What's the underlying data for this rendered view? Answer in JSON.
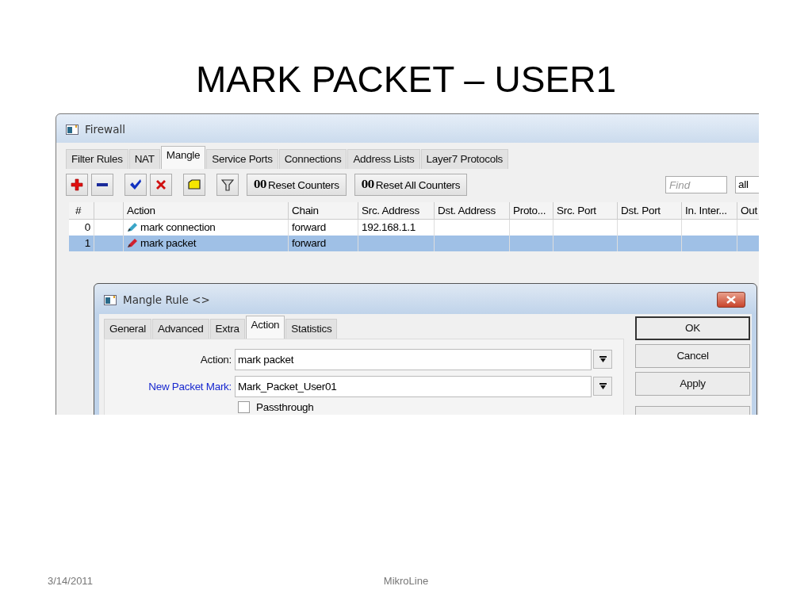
{
  "slide": {
    "title": "MARK PACKET – USER1",
    "date": "3/14/2011",
    "footer": "MikroLine"
  },
  "window": {
    "title": "Firewall",
    "tabs": [
      {
        "label": "Filter Rules",
        "selected": false
      },
      {
        "label": "NAT",
        "selected": false
      },
      {
        "label": "Mangle",
        "selected": true
      },
      {
        "label": "Service Ports",
        "selected": false
      },
      {
        "label": "Connections",
        "selected": false
      },
      {
        "label": "Address Lists",
        "selected": false
      },
      {
        "label": "Layer7 Protocols",
        "selected": false
      }
    ],
    "toolbar": [
      {
        "kind": "add"
      },
      {
        "kind": "remove"
      },
      {
        "kind": "enable"
      },
      {
        "kind": "disable"
      },
      {
        "kind": "comment"
      },
      {
        "kind": "filter"
      },
      {
        "kind": "text",
        "badge": "00",
        "label": "Reset Counters"
      },
      {
        "kind": "text",
        "badge": "00",
        "label": "Reset All Counters"
      }
    ],
    "find": {
      "placeholder": "Find"
    },
    "filter_select": "all",
    "table": {
      "columns": [
        "#",
        "Action",
        "Chain",
        "Src. Address",
        "Dst. Address",
        "Proto...",
        "Src. Port",
        "Dst. Port",
        "In. Inter...",
        "Out"
      ],
      "rows": [
        {
          "number": "0",
          "action": "mark connection",
          "chain": "forward",
          "src_address": "192.168.1.1",
          "color": "#3aa6c8",
          "selected": false
        },
        {
          "number": "1",
          "action": "mark packet",
          "chain": "forward",
          "selected": true,
          "color": "#d02030"
        }
      ]
    }
  },
  "dialog": {
    "title": "Mangle Rule <>",
    "tabs": [
      {
        "label": "General",
        "selected": false
      },
      {
        "label": "Advanced",
        "selected": false
      },
      {
        "label": "Extra",
        "selected": false
      },
      {
        "label": "Action",
        "selected": true
      },
      {
        "label": "Statistics",
        "selected": false
      }
    ],
    "fields": [
      {
        "label": "Action:",
        "value": "mark packet",
        "modified": false
      },
      {
        "label": "New Packet Mark:",
        "value": "Mark_Packet_User01",
        "modified": true
      }
    ],
    "checkbox": {
      "label": "Passthrough",
      "checked": false
    },
    "buttons": [
      {
        "label": "OK",
        "default": true
      },
      {
        "label": "Cancel",
        "default": false
      },
      {
        "label": "Apply",
        "default": false
      }
    ]
  }
}
